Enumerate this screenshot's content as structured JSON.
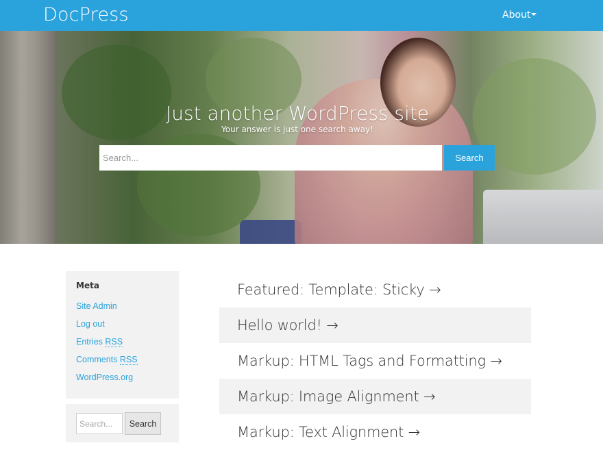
{
  "navbar": {
    "brand": "DocPress",
    "about_label": "About",
    "color": "#2aa3dd"
  },
  "hero": {
    "title": "Just another WordPress site",
    "subtitle": "Your answer is just one search away!",
    "search_placeholder": "Search...",
    "search_button": "Search"
  },
  "sidebar": {
    "meta_title": "Meta",
    "meta_links": [
      {
        "label": "Site Admin"
      },
      {
        "label": "Log out"
      },
      {
        "label_prefix": "Entries",
        "label_abbr": "RSS"
      },
      {
        "label_prefix": "Comments",
        "label_abbr": "RSS"
      },
      {
        "label": "WordPress.org"
      }
    ],
    "search_placeholder": "Search...",
    "search_button": "Search"
  },
  "posts": [
    {
      "title": "Featured: Template: Sticky →"
    },
    {
      "title": "Hello world! →"
    },
    {
      "title": "Markup: HTML Tags and Formatting →"
    },
    {
      "title": "Markup: Image Alignment →"
    },
    {
      "title": "Markup: Text Alignment →"
    }
  ]
}
